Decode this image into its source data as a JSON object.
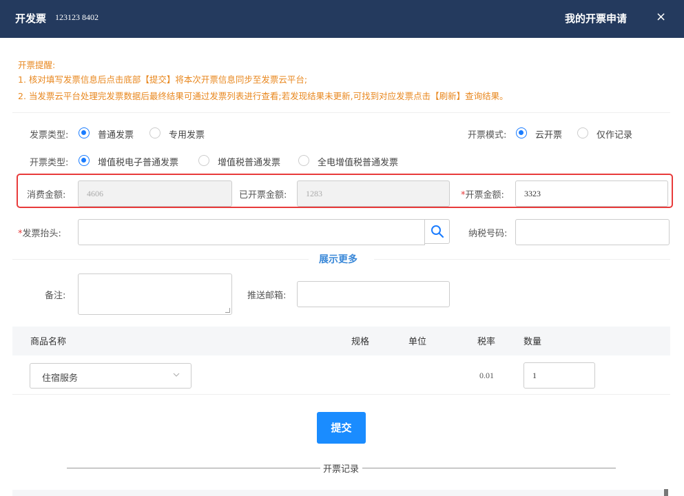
{
  "header": {
    "title": "开发票",
    "subtitle": "123123  8402",
    "my_requests": "我的开票申请",
    "close": "×"
  },
  "notice": {
    "heading": "开票提醒:",
    "line1": "1. 核对填写发票信息后点击底部【提交】将本次开票信息同步至发票云平台;",
    "line2": "2. 当发票云平台处理完发票数据后最终结果可通过发票列表进行查看;若发现结果未更新,可找到对应发票点击【刷新】查询结果。"
  },
  "invoice_kind": {
    "label": "发票类型:",
    "options": [
      "普通发票",
      "专用发票"
    ],
    "selected": "普通发票"
  },
  "invoice_mode": {
    "label": "开票模式:",
    "options": [
      "云开票",
      "仅作记录"
    ],
    "selected": "云开票"
  },
  "invoice_type": {
    "label": "开票类型:",
    "options": [
      "增值税电子普通发票",
      "增值税普通发票",
      "全电增值税普通发票"
    ],
    "selected": "增值税电子普通发票"
  },
  "amounts": {
    "consumption_label": "消费金额:",
    "consumption_value": "4606",
    "invoiced_label": "已开票金额:",
    "invoiced_value": "1283",
    "amount_label": "开票金额:",
    "amount_value": "3323",
    "required_mark": "*"
  },
  "buyer": {
    "header_label": "发票抬头:",
    "header_value": "",
    "tax_label": "纳税号码:",
    "tax_value": ""
  },
  "show_more": "展示更多",
  "extra": {
    "remark_label": "备注:",
    "email_label": "推送邮箱:"
  },
  "table": {
    "headers": [
      "商品名称",
      "规格",
      "单位",
      "税率",
      "数量"
    ],
    "row": {
      "product": "住宿服务",
      "tax_rate": "0.01",
      "quantity": "1"
    }
  },
  "submit": "提交",
  "records": "开票记录",
  "colors": {
    "header_bg": "#243a5e",
    "accent": "#1a8cff",
    "notice": "#e8871e",
    "highlight": "#e83a3a"
  }
}
